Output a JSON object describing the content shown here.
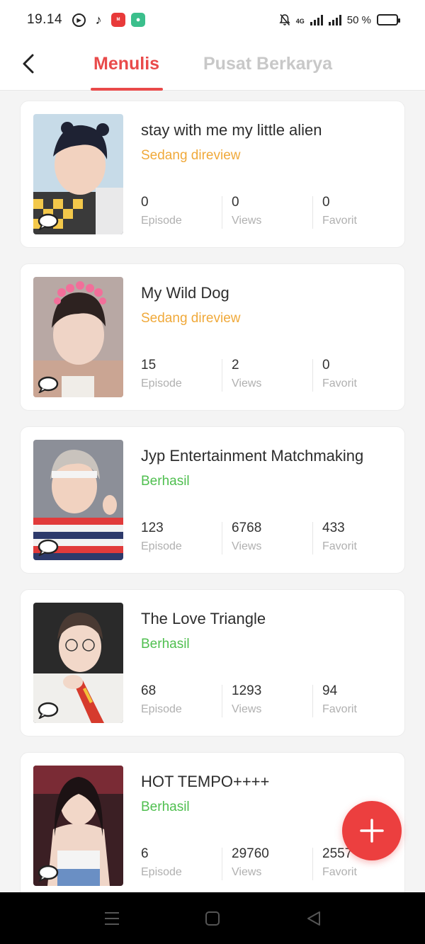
{
  "status_bar": {
    "time": "19.14",
    "network": "4G",
    "battery_text": "50 %",
    "battery_level": 0.5
  },
  "header": {
    "tabs": [
      {
        "label": "Menulis",
        "active": true
      },
      {
        "label": "Pusat Berkarya",
        "active": false
      }
    ]
  },
  "colors": {
    "accent": "#e94a4a",
    "review": "#f0a93a",
    "success": "#4fbf4f"
  },
  "stat_labels": {
    "episode": "Episode",
    "views": "Views",
    "favorit": "Favorit"
  },
  "stories": [
    {
      "title": "stay with me my little alien",
      "status": "Sedang direview",
      "status_type": "review",
      "episodes": "0",
      "views": "0",
      "favorit": "0"
    },
    {
      "title": "My Wild Dog",
      "status": "Sedang direview",
      "status_type": "review",
      "episodes": "15",
      "views": "2",
      "favorit": "0"
    },
    {
      "title": "Jyp Entertainment Matchmaking",
      "status": "Berhasil",
      "status_type": "success",
      "episodes": "123",
      "views": "6768",
      "favorit": "433"
    },
    {
      "title": "The Love Triangle",
      "status": "Berhasil",
      "status_type": "success",
      "episodes": "68",
      "views": "1293",
      "favorit": "94"
    },
    {
      "title": "HOT TEMPO++++",
      "status": "Berhasil",
      "status_type": "success",
      "episodes": "6",
      "views": "29760",
      "favorit": "2557"
    }
  ],
  "icons": {
    "back": "chevron-left-icon",
    "add": "plus-icon",
    "nav": [
      "menu-icon",
      "home-square-icon",
      "back-triangle-icon"
    ]
  }
}
